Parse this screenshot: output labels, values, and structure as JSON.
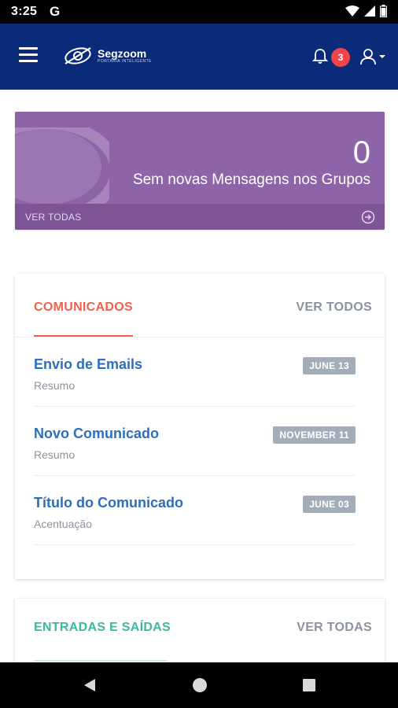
{
  "status_bar": {
    "time": "3:25",
    "g_label": "G"
  },
  "app_bar": {
    "brand_name": "Segzoom",
    "brand_tagline": "PORTARIA INTELIGENTE",
    "notification_count": "3"
  },
  "messages_card": {
    "count": "0",
    "caption": "Sem novas Mensagens nos Grupos",
    "footer_link": "VER TODAS"
  },
  "comunicados": {
    "title": "COMUNICADOS",
    "action": "VER TODOS",
    "items": [
      {
        "title": "Envio de Emails",
        "subtitle": "Resumo",
        "date": "JUNE 13"
      },
      {
        "title": "Novo Comunicado",
        "subtitle": "Resumo",
        "date": "NOVEMBER 11"
      },
      {
        "title": "Título do Comunicado",
        "subtitle": "Acentuação",
        "date": "JUNE 03"
      }
    ]
  },
  "entradas": {
    "title": "ENTRADAS E SAÍDAS",
    "action": "VER TODAS"
  },
  "colors": {
    "app_bar": "#0a2a7a",
    "messages_card": "#8e64a8",
    "comunicados_accent": "#f0604d",
    "entradas_accent": "#3fb79a",
    "item_title": "#2d6fb8",
    "date_badge": "#a3adb7",
    "notification_badge": "#f4444b"
  }
}
